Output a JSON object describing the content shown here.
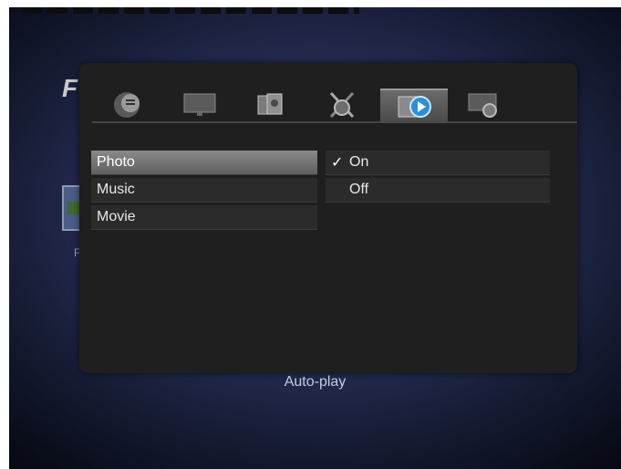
{
  "background": {
    "logo_text": "F",
    "side_letter": "F"
  },
  "tabs": [
    {
      "icon": "speech-bubble-icon"
    },
    {
      "icon": "monitor-icon"
    },
    {
      "icon": "photo-frames-icon"
    },
    {
      "icon": "tools-gear-icon"
    },
    {
      "icon": "media-play-icon",
      "active": true
    },
    {
      "icon": "system-gear-icon"
    }
  ],
  "menu": {
    "items": [
      {
        "label": "Photo",
        "selected": true
      },
      {
        "label": "Music"
      },
      {
        "label": "Movie"
      }
    ]
  },
  "options": {
    "items": [
      {
        "check": "✓",
        "label": "On"
      },
      {
        "check": "",
        "label": "Off"
      }
    ]
  },
  "footer": {
    "title": "Auto-play"
  },
  "colors": {
    "panel": "#1f1f1f",
    "selected_row": "#7a7a7a",
    "screen_bg": "#232a4d"
  }
}
